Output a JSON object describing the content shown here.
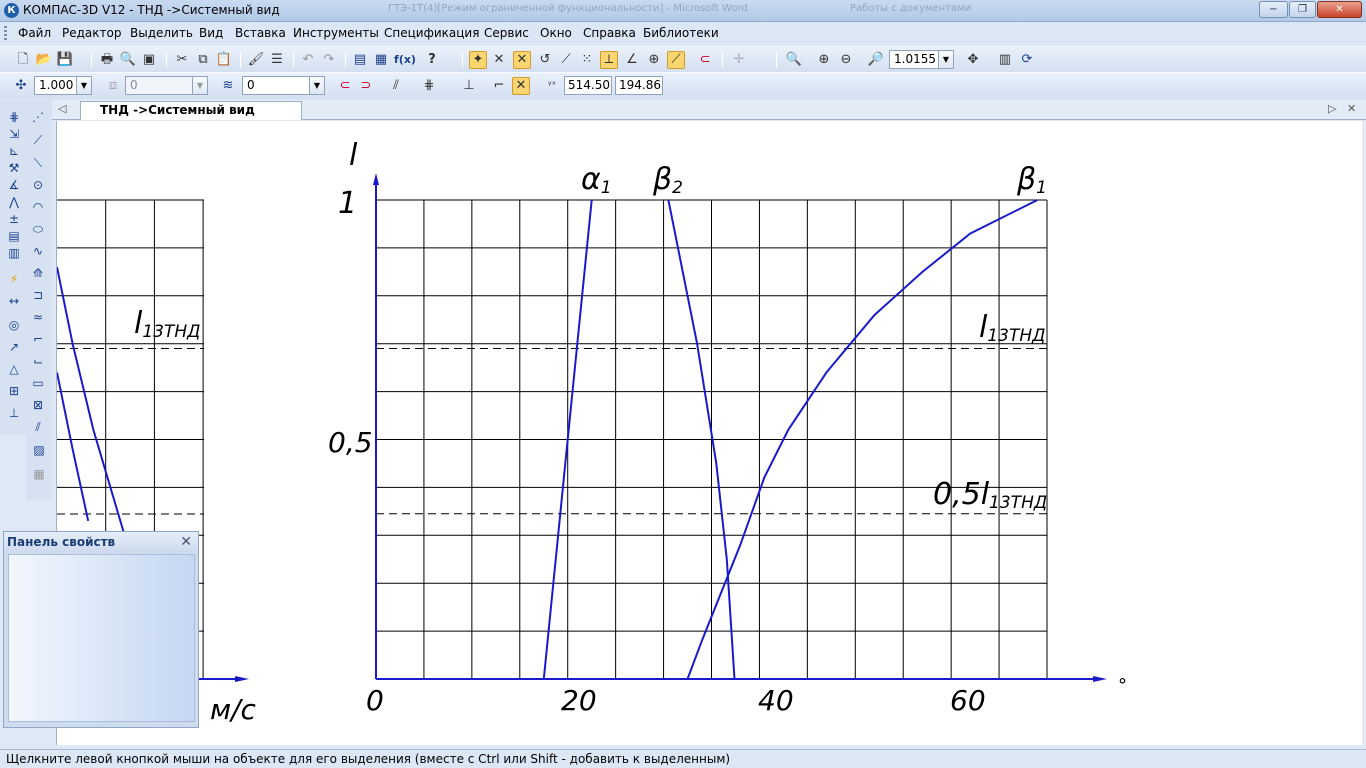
{
  "window": {
    "app_icon": "К",
    "title": "КОМПАС-3D V12 - ТНД ->Системный вид",
    "background_titles": [
      "ГТЭ-1T(4)[Режим ограниченной функциональности] - Microsoft Word",
      "Работы с документами"
    ],
    "controls": {
      "minimize": "−",
      "maximize": "❐",
      "close": "✕"
    }
  },
  "menu": {
    "items": [
      "Файл",
      "Редактор",
      "Выделить",
      "Вид",
      "Вставка",
      "Инструменты",
      "Спецификация",
      "Сервис",
      "Окно",
      "Справка",
      "Библиотеки"
    ]
  },
  "toolbar_standard": {
    "icons": [
      "new-icon",
      "open-icon",
      "save-icon",
      "print-icon",
      "print-preview-icon",
      "preview-icon",
      "cut-icon",
      "copy-icon",
      "paste-icon",
      "format-brush-icon",
      "properties-icon",
      "undo-icon",
      "redo-icon",
      "manager-icon",
      "variables-icon",
      "fx-icon",
      "help-icon",
      "snap-icons"
    ],
    "fx_label": "f(x)",
    "zoom_value": "1.0155"
  },
  "toolbar_current_state": {
    "step_value": "1.000",
    "angle_value": "0",
    "layer_value": "0",
    "cursor_x": "514.503",
    "cursor_y": "194.863"
  },
  "document": {
    "tab_title": "ТНД ->Системный вид"
  },
  "properties_panel": {
    "title": "Панель свойств",
    "close_label": "✕"
  },
  "status_bar": {
    "text": "Щелкните левой кнопкой мыши на объекте для его выделения (вместе с Ctrl или Shift - добавить к выделенным)"
  },
  "chart_data": [
    {
      "type": "line",
      "title": "",
      "xlabel": "°",
      "ylabel": "l",
      "xlim": [
        0,
        70
      ],
      "ylim": [
        0,
        1
      ],
      "x_ticks": [
        "0",
        "20",
        "40",
        "60"
      ],
      "y_ticks": [
        "0,5",
        "1"
      ],
      "grid": true,
      "reference_lines": [
        {
          "label": "l",
          "subscript": "13ТНД",
          "y": 0.69
        },
        {
          "label": "0,5l",
          "subscript": "13ТНД",
          "y": 0.345
        }
      ],
      "series": [
        {
          "name": "α",
          "subscript": "1",
          "points": [
            [
              17.5,
              0
            ],
            [
              19.5,
              0.4
            ],
            [
              21,
              0.7
            ],
            [
              22.5,
              1.0
            ]
          ]
        },
        {
          "name": "β",
          "subscript": "2",
          "points": [
            [
              30.5,
              1.0
            ],
            [
              33.5,
              0.7
            ],
            [
              35.5,
              0.45
            ],
            [
              36.6,
              0.25
            ],
            [
              37.4,
              0
            ]
          ]
        },
        {
          "name": "β",
          "subscript": "1",
          "points": [
            [
              32.5,
              0
            ],
            [
              34,
              0.08
            ],
            [
              36,
              0.18
            ],
            [
              38,
              0.28
            ],
            [
              40.5,
              0.42
            ],
            [
              43,
              0.52
            ],
            [
              47,
              0.64
            ],
            [
              52,
              0.76
            ],
            [
              57,
              0.85
            ],
            [
              62,
              0.93
            ],
            [
              69,
              1.0
            ]
          ]
        }
      ]
    },
    {
      "type": "line",
      "title": "",
      "xlabel": "м/с",
      "ylabel": "",
      "grid": true,
      "reference_lines": [
        {
          "label": "l",
          "subscript": "13ТНД",
          "y": 0.69
        }
      ],
      "series": [
        {
          "name": "",
          "points": [
            [
              0,
              0.86
            ],
            [
              0.6,
              0.7
            ],
            [
              1.4,
              0.52
            ],
            [
              2.6,
              0.3
            ]
          ]
        },
        {
          "name": "",
          "points": [
            [
              0,
              0.64
            ],
            [
              0.6,
              0.48
            ],
            [
              1.2,
              0.33
            ]
          ]
        }
      ]
    }
  ]
}
